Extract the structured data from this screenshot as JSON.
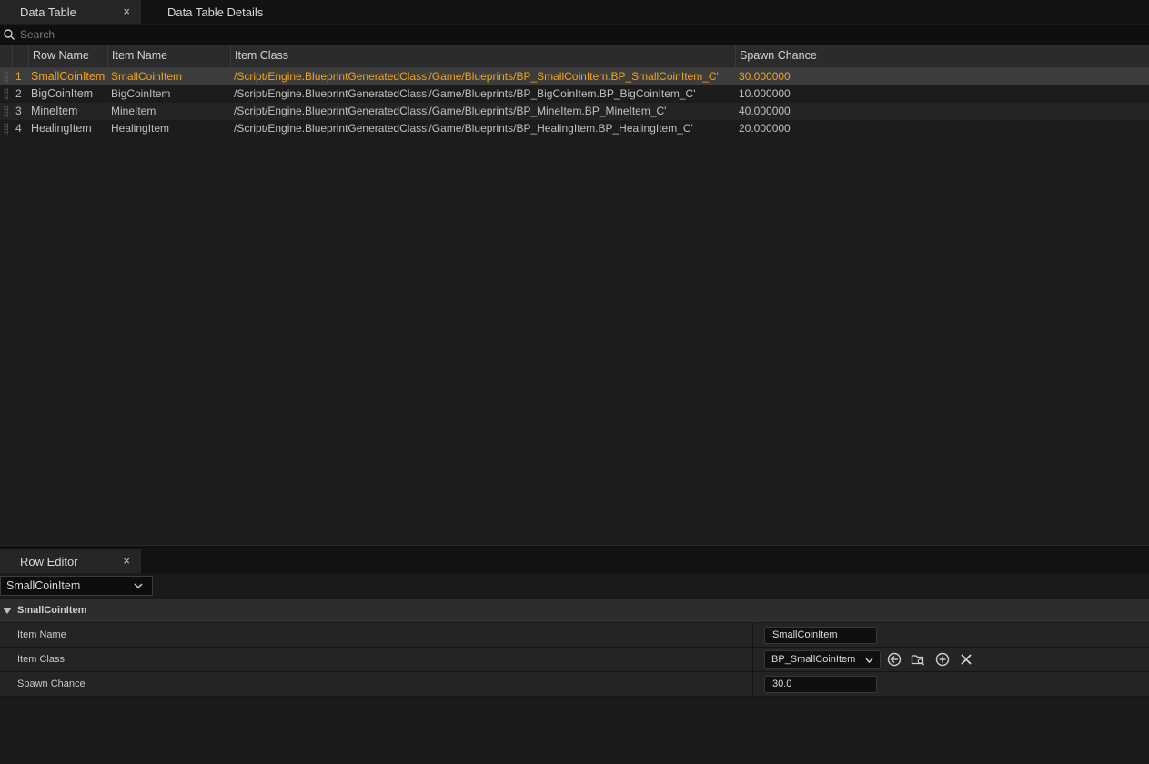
{
  "top_tabs": [
    {
      "label": "Data Table",
      "close": "×",
      "active": true
    },
    {
      "label": "Data Table Details",
      "active": false
    }
  ],
  "search": {
    "placeholder": "Search",
    "value": ""
  },
  "table": {
    "columns": [
      "Row Name",
      "Item Name",
      "Item Class",
      "Spawn Chance"
    ],
    "rows": [
      {
        "index": "1",
        "row_name": "SmallCoinItem",
        "item_name": "SmallCoinItem",
        "item_class": "/Script/Engine.BlueprintGeneratedClass'/Game/Blueprints/BP_SmallCoinItem.BP_SmallCoinItem_C'",
        "spawn_chance": "30.000000",
        "selected": true
      },
      {
        "index": "2",
        "row_name": "BigCoinItem",
        "item_name": "BigCoinItem",
        "item_class": "/Script/Engine.BlueprintGeneratedClass'/Game/Blueprints/BP_BigCoinItem.BP_BigCoinItem_C'",
        "spawn_chance": "10.000000",
        "selected": false
      },
      {
        "index": "3",
        "row_name": "MineItem",
        "item_name": "MineItem",
        "item_class": "/Script/Engine.BlueprintGeneratedClass'/Game/Blueprints/BP_MineItem.BP_MineItem_C'",
        "spawn_chance": "40.000000",
        "selected": false
      },
      {
        "index": "4",
        "row_name": "HealingItem",
        "item_name": "HealingItem",
        "item_class": "/Script/Engine.BlueprintGeneratedClass'/Game/Blueprints/BP_HealingItem.BP_HealingItem_C'",
        "spawn_chance": "20.000000",
        "selected": false
      }
    ]
  },
  "row_editor": {
    "tab": {
      "label": "Row Editor",
      "close": "×"
    },
    "row_selector": {
      "value": "SmallCoinItem"
    },
    "section_title": "SmallCoinItem",
    "properties": {
      "item_name": {
        "label": "Item Name",
        "value": "SmallCoinItem"
      },
      "item_class": {
        "label": "Item Class",
        "value": "BP_SmallCoinItem"
      },
      "spawn_chance": {
        "label": "Spawn Chance",
        "value": "30.0"
      }
    }
  },
  "colors": {
    "accent": "#f2a31b",
    "background": "#1a1a1a",
    "header": "#2b2b2b",
    "selected_row": "#3d3d3d"
  },
  "icons": [
    "search-icon",
    "close-icon",
    "chevron-down-icon",
    "browse-back-icon",
    "browse-asset-icon",
    "add-icon",
    "clear-icon",
    "collapse-triangle-icon"
  ]
}
